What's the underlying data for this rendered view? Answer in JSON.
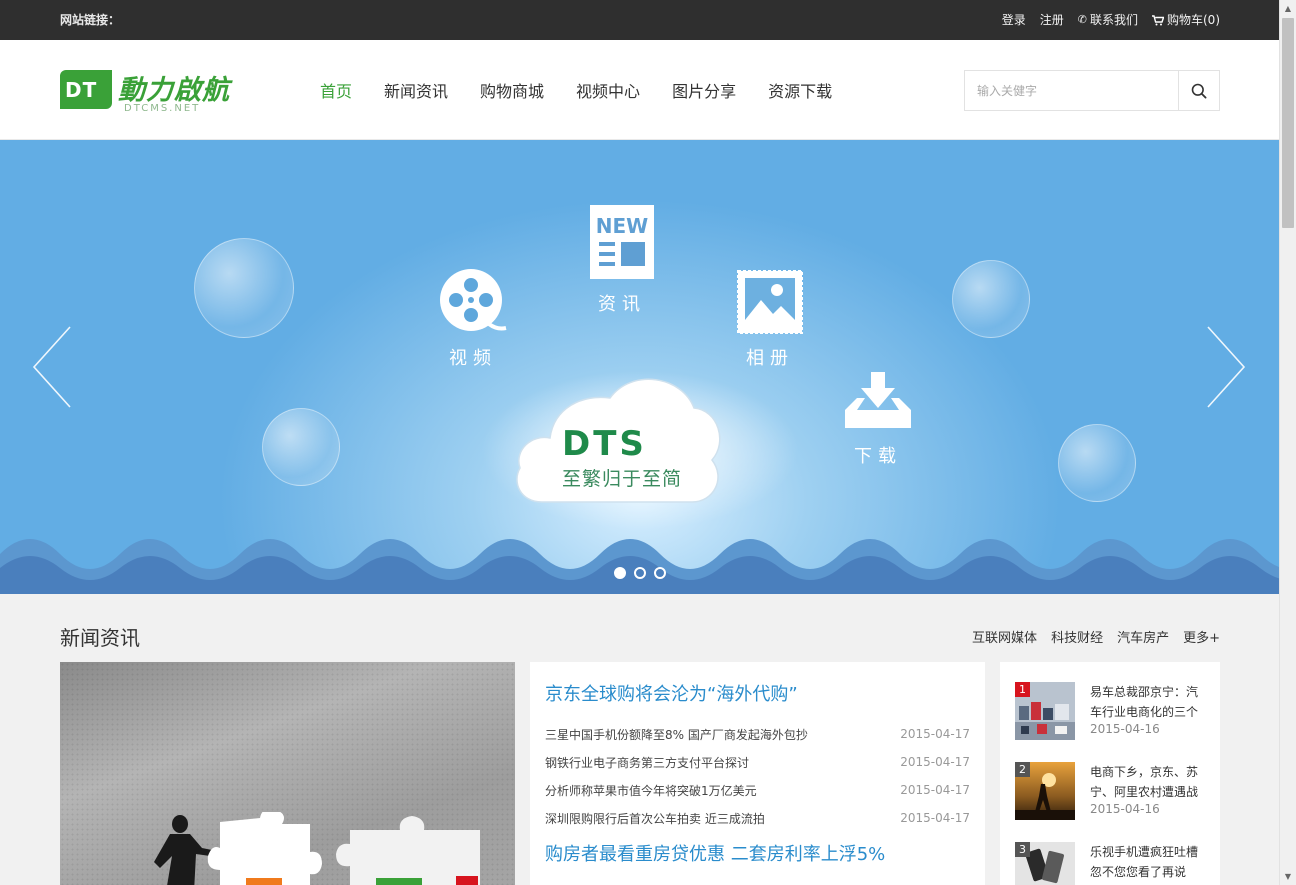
{
  "topbar": {
    "site_links": "网站链接：",
    "login": "登录",
    "register": "注册",
    "contact": "联系我们",
    "cart": "购物车(0)"
  },
  "logo": {
    "mark": "DT",
    "title": "動力啟航",
    "subtitle": "DTCMS.NET"
  },
  "nav": {
    "items": [
      {
        "label": "首页",
        "active": true
      },
      {
        "label": "新闻资讯",
        "active": false
      },
      {
        "label": "购物商城",
        "active": false
      },
      {
        "label": "视频中心",
        "active": false
      },
      {
        "label": "图片分享",
        "active": false
      },
      {
        "label": "资源下载",
        "active": false
      }
    ]
  },
  "search": {
    "placeholder": "输入关健字"
  },
  "banner": {
    "features": {
      "video": "视频",
      "news_badge": "NEW",
      "news": "资讯",
      "album": "相册",
      "download": "下载"
    },
    "cloud_mark": "DTS",
    "cloud_tagline": "至繁归于至简",
    "slides_count": 3,
    "active_slide": 1
  },
  "news_section": {
    "title": "新闻资讯",
    "tabs": [
      "互联网媒体",
      "科技财经",
      "汽车房产",
      "更多+"
    ],
    "headline_1": "京东全球购将会沦为“海外代购”",
    "list_1": [
      {
        "title": "三星中国手机份额降至8% 国产厂商发起海外包抄",
        "date": "2015-04-17"
      },
      {
        "title": "钢铁行业电子商务第三方支付平台探讨",
        "date": "2015-04-17"
      },
      {
        "title": "分析师称苹果市值今年将突破1万亿美元",
        "date": "2015-04-17"
      },
      {
        "title": "深圳限购限行后首次公车拍卖 近三成流拍",
        "date": "2015-04-17"
      }
    ],
    "headline_2": "购房者最看重房贷优惠 二套房利率上浮5%",
    "side": [
      {
        "num": "1",
        "title": "易车总裁邵京宁：汽车行业电商化的三个",
        "date": "2015-04-16"
      },
      {
        "num": "2",
        "title": "电商下乡，京东、苏宁、阿里农村遭遇战",
        "date": "2015-04-16"
      },
      {
        "num": "3",
        "title": "乐视手机遭疯狂吐槽 忽不您您看了再说",
        "date": ""
      }
    ]
  },
  "colors": {
    "brand_green": "#3aa138",
    "link_blue": "#2a8ccc",
    "topbar_bg": "#2f2f2f",
    "rank_red": "#d7141e",
    "rank_gray": "#555555"
  }
}
